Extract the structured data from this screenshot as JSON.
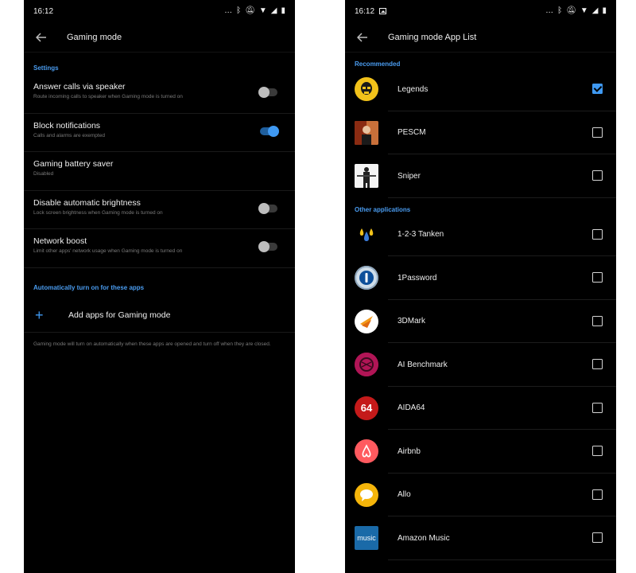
{
  "left": {
    "status": {
      "time": "16:12",
      "icons": [
        "more-icon",
        "bluetooth-icon",
        "mute-icon",
        "wifi-icon",
        "signal-icon",
        "battery-icon"
      ]
    },
    "toolbar": {
      "title": "Gaming mode"
    },
    "settings_header": "Settings",
    "settings": [
      {
        "title": "Answer calls via speaker",
        "subtitle": "Route incoming calls to speaker when Gaming mode is turned on",
        "toggle": "off"
      },
      {
        "title": "Block notifications",
        "subtitle": "Calls and alarms are exempted",
        "toggle": "on"
      },
      {
        "title": "Gaming battery saver",
        "subtitle": "Disabled",
        "toggle": null
      },
      {
        "title": "Disable automatic brightness",
        "subtitle": "Lock screen brightness when Gaming mode is turned on",
        "toggle": "off"
      },
      {
        "title": "Network boost",
        "subtitle": "Limit other apps' network usage when Gaming mode is turned on",
        "toggle": "off"
      }
    ],
    "auto_header": "Automatically turn on for these apps",
    "add_label": "Add apps for Gaming mode",
    "footer_note": "Gaming mode will turn on automatically when these apps are opened and turn off when they are closed."
  },
  "right": {
    "status": {
      "time": "16:12",
      "icons": [
        "gallery-icon",
        "more-icon",
        "bluetooth-icon",
        "mute-icon",
        "wifi-icon",
        "signal-icon",
        "battery-icon"
      ]
    },
    "toolbar": {
      "title": "Gaming mode App List"
    },
    "recommended_header": "Recommended",
    "recommended": [
      {
        "name": "Legends",
        "checked": true,
        "icon": "legends-icon"
      },
      {
        "name": "PESCM",
        "checked": false,
        "icon": "pescm-icon"
      },
      {
        "name": "Sniper",
        "checked": false,
        "icon": "sniper-icon"
      }
    ],
    "other_header": "Other applications",
    "other": [
      {
        "name": "1-2-3 Tanken",
        "checked": false,
        "icon": "tanken-icon"
      },
      {
        "name": "1Password",
        "checked": false,
        "icon": "onepassword-icon"
      },
      {
        "name": "3DMark",
        "checked": false,
        "icon": "threedmark-icon"
      },
      {
        "name": "AI Benchmark",
        "checked": false,
        "icon": "ai-benchmark-icon"
      },
      {
        "name": "AIDA64",
        "checked": false,
        "icon": "aida64-icon",
        "glyph": "64"
      },
      {
        "name": "Airbnb",
        "checked": false,
        "icon": "airbnb-icon"
      },
      {
        "name": "Allo",
        "checked": false,
        "icon": "allo-icon"
      },
      {
        "name": "Amazon Music",
        "checked": false,
        "icon": "amazon-music-icon",
        "glyph": "music"
      }
    ]
  },
  "colors": {
    "accent": "#3f99f2",
    "background": "#000000"
  }
}
